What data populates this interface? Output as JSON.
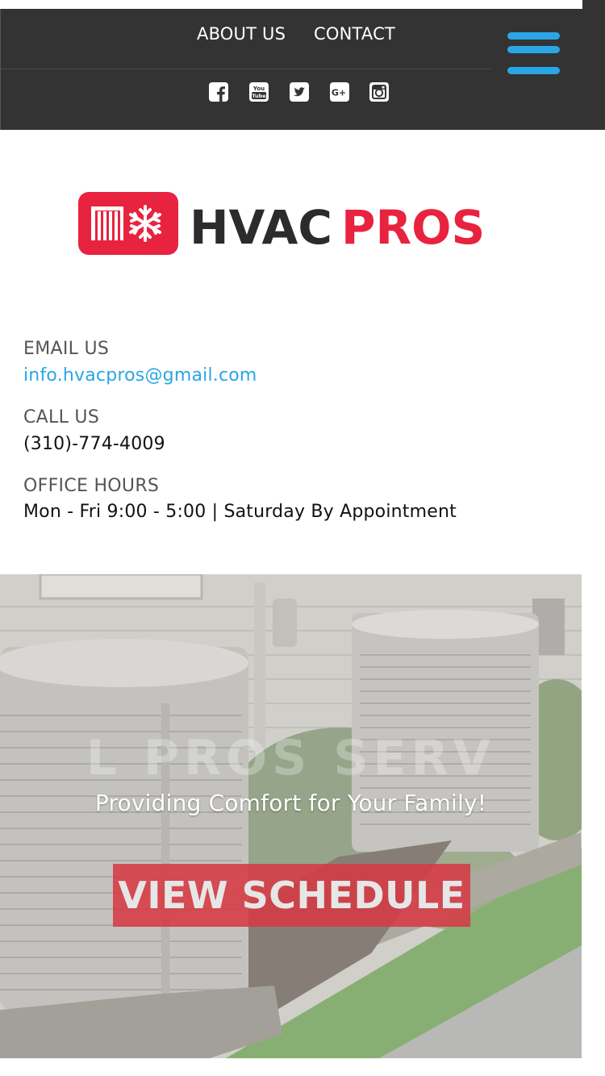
{
  "nav": {
    "about_label": "ABOUT US",
    "contact_label": "CONTACT",
    "menu_icon": "hamburger-menu-icon",
    "social": [
      "facebook-icon",
      "youtube-icon",
      "twitter-icon",
      "google-plus-icon",
      "instagram-icon"
    ]
  },
  "logo": {
    "part1": "HVAC",
    "part2": "PROS",
    "icon": "radiator-snowflake-icon"
  },
  "contact": {
    "email_label": "EMAIL US",
    "email_value": "info.hvacpros@gmail.com",
    "call_label": "CALL US",
    "call_value": "(310)-774-4009",
    "hours_label": "OFFICE HOURS",
    "hours_value": "Mon - Fri 9:00 - 5:00 | Saturday By Appointment"
  },
  "hero": {
    "ghost_text": "L PROS SERV",
    "tagline": "Providing Comfort for Your Family!",
    "button_label": "VIEW SCHEDULE"
  },
  "colors": {
    "header_bg": "#333333",
    "accent_blue": "#2aa6e6",
    "brand_red": "#e8233f",
    "button_red": "#d63a44"
  }
}
